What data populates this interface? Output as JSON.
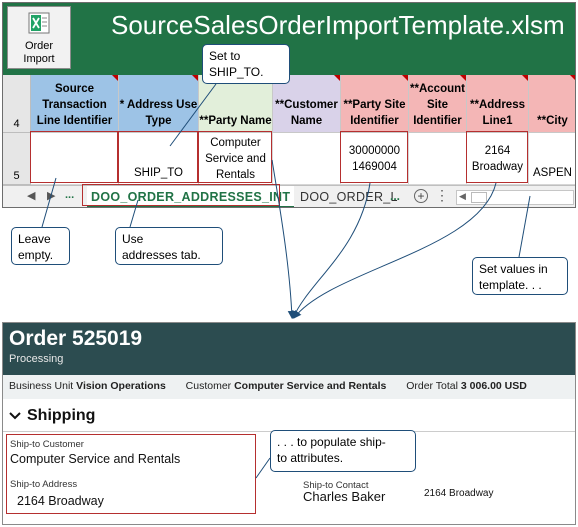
{
  "excel": {
    "title": "SourceSalesOrderImportTemplate.xlsm",
    "order_import_button": "Order\nImport",
    "row_numbers": [
      "4",
      "5"
    ],
    "columns": [
      {
        "header": "Source\nTransaction\nLine Identifier",
        "value": "",
        "bg": "#9dc3e6"
      },
      {
        "header": "* Address Use\nType",
        "value": "SHIP_TO",
        "bg": "#9dc3e6"
      },
      {
        "header": "**Party Name",
        "value": "Computer\nService and\nRentals",
        "bg": "#e2efda"
      },
      {
        "header": "**Customer\nName",
        "value": "",
        "bg": "#d9d2e9"
      },
      {
        "header": "**Party Site\nIdentifier",
        "value": "30000000\n1469004",
        "bg": "#f4b6b6"
      },
      {
        "header": "**Account\nSite\nIdentifier",
        "value": "",
        "bg": "#f4b6b6"
      },
      {
        "header": "**Address\nLine1",
        "value": "2164\nBroadway",
        "bg": "#f4b6b6"
      },
      {
        "header": "**City",
        "value": "ASPEN",
        "bg": "#f4b6b6"
      }
    ],
    "tabs": {
      "active": "DOO_ORDER_ADDRESSES_INT",
      "other": "DOO_ORDER_L",
      "ellipsis_left": "...",
      "ellipsis_right": "..."
    }
  },
  "callouts": {
    "set_to": "Set to\nSHIP_TO.",
    "leave_empty": "Leave\nempty.",
    "use_tab": "Use\naddresses tab.",
    "set_values": "Set values  in\ntemplate. . .",
    "populate": ". . . to populate ship-\nto attributes."
  },
  "order": {
    "title": "Order 525019",
    "status": "Processing",
    "business_unit_label": "Business Unit",
    "business_unit_value": "Vision Operations",
    "customer_label": "Customer",
    "customer_value": "Computer Service and Rentals",
    "total_label": "Order Total",
    "total_value": "3 006.00 USD",
    "section_title": "Shipping",
    "ship_to_customer_label": "Ship-to Customer",
    "ship_to_customer_value": "Computer Service and Rentals",
    "ship_to_address_label": "Ship-to Address",
    "ship_to_address_value": "2164 Broadway",
    "ship_to_contact_label": "Ship-to Contact",
    "ship_to_contact_value": "Charles Baker",
    "extra_address": "2164 Broadway"
  },
  "colors": {
    "excel_green": "#217346",
    "oracle_header": "#2c4c50",
    "highlight_red": "#b52f2f",
    "callout_border": "#1f4e79"
  }
}
